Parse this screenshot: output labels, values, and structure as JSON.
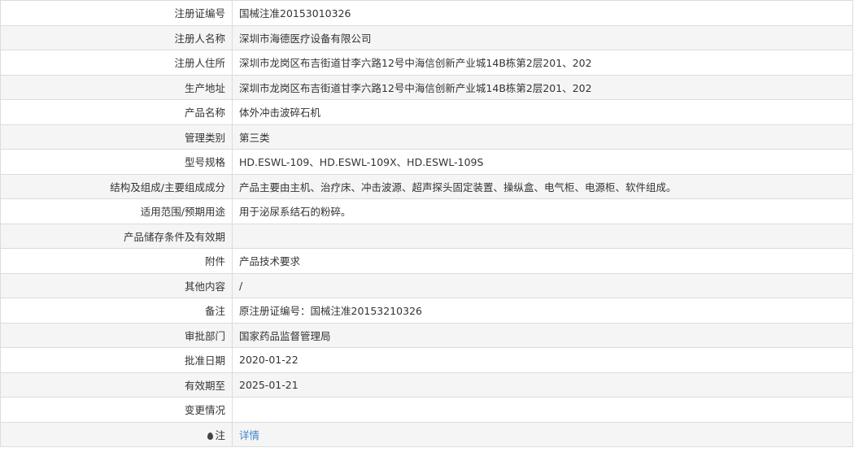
{
  "rows": [
    {
      "label": "注册证编号",
      "value": "国械注准20153010326"
    },
    {
      "label": "注册人名称",
      "value": "深圳市海德医疗设备有限公司"
    },
    {
      "label": "注册人住所",
      "value": "深圳市龙岗区布吉街道甘李六路12号中海信创新产业城14B栋第2层201、202"
    },
    {
      "label": "生产地址",
      "value": "深圳市龙岗区布吉街道甘李六路12号中海信创新产业城14B栋第2层201、202"
    },
    {
      "label": "产品名称",
      "value": "体外冲击波碎石机"
    },
    {
      "label": "管理类别",
      "value": "第三类"
    },
    {
      "label": "型号规格",
      "value": "HD.ESWL-109、HD.ESWL-109X、HD.ESWL-109S"
    },
    {
      "label": "结构及组成/主要组成成分",
      "value": "产品主要由主机、治疗床、冲击波源、超声探头固定装置、操纵盒、电气柜、电源柜、软件组成。"
    },
    {
      "label": "适用范围/预期用途",
      "value": "用于泌尿系结石的粉碎。"
    },
    {
      "label": "产品储存条件及有效期",
      "value": ""
    },
    {
      "label": "附件",
      "value": "产品技术要求"
    },
    {
      "label": "其他内容",
      "value": "/"
    },
    {
      "label": "备注",
      "value": "原注册证编号：国械注准20153210326"
    },
    {
      "label": "审批部门",
      "value": "国家药品监督管理局"
    },
    {
      "label": "批准日期",
      "value": "2020-01-22"
    },
    {
      "label": "有效期至",
      "value": "2025-01-21"
    },
    {
      "label": "变更情况",
      "value": ""
    }
  ],
  "note_row": {
    "label": "注",
    "icon": "note-icon",
    "link_text": "详情"
  }
}
